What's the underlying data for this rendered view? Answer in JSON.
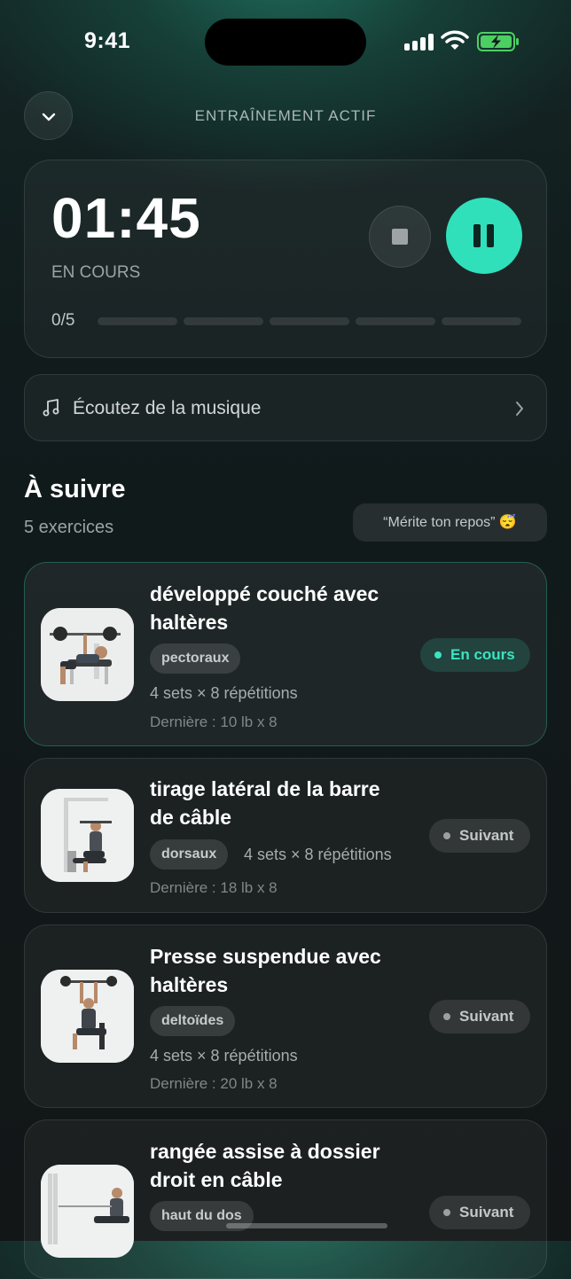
{
  "status_bar": {
    "time": "9:41"
  },
  "header": {
    "title": "ENTRAÎNEMENT ACTIF"
  },
  "timer": {
    "elapsed": "01:45",
    "status": "EN COURS",
    "progress_label": "0/5",
    "completed": 0,
    "total": 5
  },
  "music": {
    "label": "Écoutez de la musique"
  },
  "section": {
    "title": "À suivre",
    "subtitle": "5 exercices",
    "quote": "“Mérite ton repos” 😴"
  },
  "exercises": [
    {
      "name": "développé couché avec haltères",
      "muscle": "pectoraux",
      "sets": "4 sets × 8 répétitions",
      "last": "Dernière : 10 lb x 8",
      "status": "En cours"
    },
    {
      "name": "tirage latéral de la barre de câble",
      "muscle": "dorsaux",
      "sets": "4 sets × 8 répétitions",
      "last": "Dernière : 18 lb x 8",
      "status": "Suivant"
    },
    {
      "name": "Presse suspendue avec haltères",
      "muscle": "deltoïdes",
      "sets": "4 sets × 8 répétitions",
      "last": "Dernière : 20 lb x 8",
      "status": "Suivant"
    },
    {
      "name": "rangée assise à dossier droit en câble",
      "muscle": "haut du dos",
      "status": "Suivant"
    }
  ],
  "colors": {
    "accent": "#2fe0bb",
    "background": "#121617"
  },
  "icons": [
    "chevron-down-icon",
    "stop-icon",
    "pause-icon",
    "music-note-icon",
    "chevron-right-icon",
    "signal-icon",
    "wifi-icon",
    "battery-icon"
  ]
}
